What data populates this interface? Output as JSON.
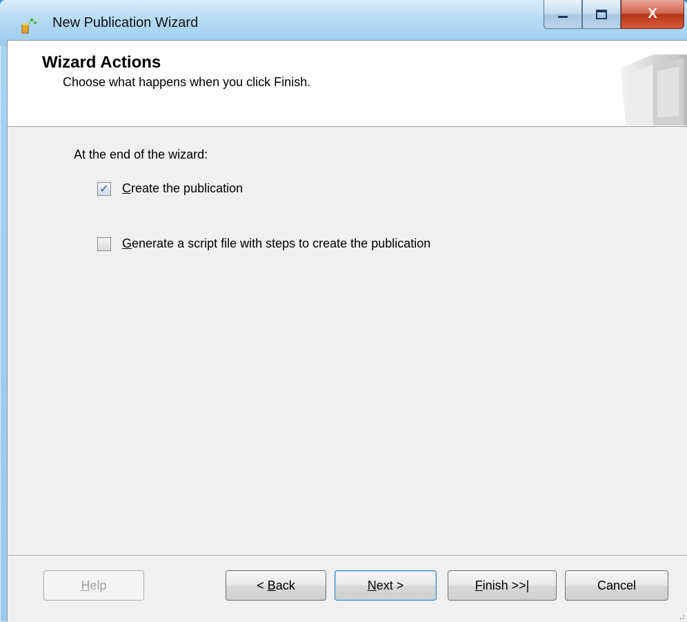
{
  "window": {
    "title": "New Publication Wizard",
    "controls": {
      "minimize": "_",
      "maximize": "□",
      "close": "X"
    }
  },
  "header": {
    "title": "Wizard Actions",
    "subtitle": "Choose what happens when you click Finish."
  },
  "body": {
    "prompt": "At the end of the wizard:",
    "options": [
      {
        "label_prefix": "C",
        "label_rest": "reate the publication",
        "checked": true
      },
      {
        "label_prefix": "G",
        "label_rest": "enerate a script file with steps to create the publication",
        "checked": false
      }
    ]
  },
  "footer": {
    "help": {
      "prefix": "",
      "mnemonic": "H",
      "rest": "elp",
      "enabled": false
    },
    "back": {
      "prefix": "< ",
      "mnemonic": "B",
      "rest": "ack"
    },
    "next": {
      "prefix": "",
      "mnemonic": "N",
      "rest": "ext >"
    },
    "finish": {
      "prefix": "",
      "mnemonic": "F",
      "rest": "inish >>|"
    },
    "cancel": {
      "label": "Cancel"
    }
  },
  "icons": {
    "app": "publication-wizard-icon",
    "header_art": "book-graphic-icon",
    "check": "checkmark-icon"
  },
  "colors": {
    "desktop": "#56a6e6",
    "close_button": "#c8452a",
    "client_bg": "#f0f0f0"
  }
}
